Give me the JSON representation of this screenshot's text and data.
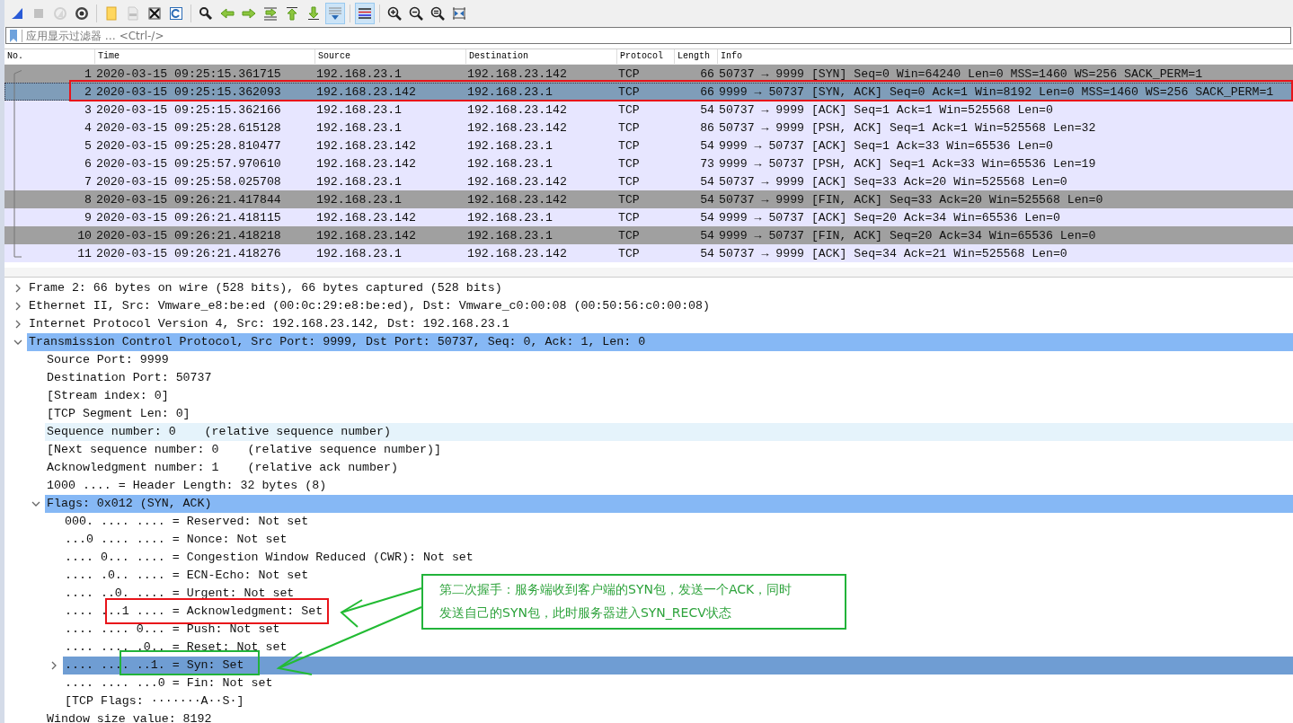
{
  "toolbar": {
    "buttons": [
      {
        "selected": false,
        "disabled": false
      },
      {
        "selected": false,
        "disabled": true
      },
      {
        "selected": false,
        "disabled": true
      },
      {
        "selected": false,
        "disabled": false
      },
      {
        "selected": false,
        "disabled": false
      },
      {
        "selected": false,
        "disabled": true
      },
      {
        "selected": false,
        "disabled": false
      },
      {
        "selected": false,
        "disabled": false
      },
      {
        "selected": false,
        "disabled": false
      },
      {
        "selected": false,
        "disabled": false
      },
      {
        "selected": false,
        "disabled": false
      },
      {
        "selected": false,
        "disabled": false
      },
      {
        "selected": false,
        "disabled": false
      },
      {
        "selected": false,
        "disabled": false
      },
      {
        "selected": true,
        "disabled": false
      },
      {
        "selected": true,
        "disabled": false
      },
      {
        "selected": false,
        "disabled": false
      },
      {
        "selected": false,
        "disabled": false
      },
      {
        "selected": false,
        "disabled": false
      },
      {
        "selected": false,
        "disabled": false
      }
    ]
  },
  "filter": {
    "placeholder": "应用显示过滤器 … <Ctrl-/>"
  },
  "packet_list": {
    "columns": [
      "No.",
      "Time",
      "Source",
      "Destination",
      "Protocol",
      "Length",
      "Info"
    ],
    "rows": [
      {
        "no": "1",
        "time": "2020-03-15 09:25:15.361715",
        "source": "192.168.23.1",
        "destination": "192.168.23.142",
        "protocol": "TCP",
        "length": "66",
        "info": "50737 → 9999 [SYN] Seq=0 Win=64240 Len=0 MSS=1460 WS=256 SACK_PERM=1",
        "color": "#a0a0a0",
        "selected": false
      },
      {
        "no": "2",
        "time": "2020-03-15 09:25:15.362093",
        "source": "192.168.23.142",
        "destination": "192.168.23.1",
        "protocol": "TCP",
        "length": "66",
        "info": "9999 → 50737 [SYN, ACK] Seq=0 Ack=1 Win=8192 Len=0 MSS=1460 WS=256 SACK_PERM=1",
        "color": "#7f9db9",
        "selected": true
      },
      {
        "no": "3",
        "time": "2020-03-15 09:25:15.362166",
        "source": "192.168.23.1",
        "destination": "192.168.23.142",
        "protocol": "TCP",
        "length": "54",
        "info": "50737 → 9999 [ACK] Seq=1 Ack=1 Win=525568 Len=0",
        "color": "#e7e6ff",
        "selected": false
      },
      {
        "no": "4",
        "time": "2020-03-15 09:25:28.615128",
        "source": "192.168.23.1",
        "destination": "192.168.23.142",
        "protocol": "TCP",
        "length": "86",
        "info": "50737 → 9999 [PSH, ACK] Seq=1 Ack=1 Win=525568 Len=32",
        "color": "#e7e6ff",
        "selected": false
      },
      {
        "no": "5",
        "time": "2020-03-15 09:25:28.810477",
        "source": "192.168.23.142",
        "destination": "192.168.23.1",
        "protocol": "TCP",
        "length": "54",
        "info": "9999 → 50737 [ACK] Seq=1 Ack=33 Win=65536 Len=0",
        "color": "#e7e6ff",
        "selected": false
      },
      {
        "no": "6",
        "time": "2020-03-15 09:25:57.970610",
        "source": "192.168.23.142",
        "destination": "192.168.23.1",
        "protocol": "TCP",
        "length": "73",
        "info": "9999 → 50737 [PSH, ACK] Seq=1 Ack=33 Win=65536 Len=19",
        "color": "#e7e6ff",
        "selected": false
      },
      {
        "no": "7",
        "time": "2020-03-15 09:25:58.025708",
        "source": "192.168.23.1",
        "destination": "192.168.23.142",
        "protocol": "TCP",
        "length": "54",
        "info": "50737 → 9999 [ACK] Seq=33 Ack=20 Win=525568 Len=0",
        "color": "#e7e6ff",
        "selected": false
      },
      {
        "no": "8",
        "time": "2020-03-15 09:26:21.417844",
        "source": "192.168.23.1",
        "destination": "192.168.23.142",
        "protocol": "TCP",
        "length": "54",
        "info": "50737 → 9999 [FIN, ACK] Seq=33 Ack=20 Win=525568 Len=0",
        "color": "#a0a0a0",
        "selected": false
      },
      {
        "no": "9",
        "time": "2020-03-15 09:26:21.418115",
        "source": "192.168.23.142",
        "destination": "192.168.23.1",
        "protocol": "TCP",
        "length": "54",
        "info": "9999 → 50737 [ACK] Seq=20 Ack=34 Win=65536 Len=0",
        "color": "#e7e6ff",
        "selected": false
      },
      {
        "no": "10",
        "time": "2020-03-15 09:26:21.418218",
        "source": "192.168.23.142",
        "destination": "192.168.23.1",
        "protocol": "TCP",
        "length": "54",
        "info": "9999 → 50737 [FIN, ACK] Seq=20 Ack=34 Win=65536 Len=0",
        "color": "#a0a0a0",
        "selected": false
      },
      {
        "no": "11",
        "time": "2020-03-15 09:26:21.418276",
        "source": "192.168.23.1",
        "destination": "192.168.23.142",
        "protocol": "TCP",
        "length": "54",
        "info": "50737 → 9999 [ACK] Seq=34 Ack=21 Win=525568 Len=0",
        "color": "#e7e6ff",
        "selected": false
      }
    ]
  },
  "details": [
    {
      "label": "Frame 2: 66 bytes on wire (528 bits), 66 bytes captured (528 bits)",
      "expanded": false,
      "selected": false
    },
    {
      "label": "Ethernet II, Src: Vmware_e8:be:ed (00:0c:29:e8:be:ed), Dst: Vmware_c0:00:08 (00:50:56:c0:00:08)",
      "expanded": false,
      "selected": false
    },
    {
      "label": "Internet Protocol Version 4, Src: 192.168.23.142, Dst: 192.168.23.1",
      "expanded": false,
      "selected": false
    },
    {
      "label": "Transmission Control Protocol, Src Port: 9999, Dst Port: 50737, Seq: 0, Ack: 1, Len: 0",
      "expanded": true,
      "selected": false,
      "related": true,
      "children": [
        {
          "label": "Source Port: 9999",
          "selected": false
        },
        {
          "label": "Destination Port: 50737",
          "selected": false
        },
        {
          "label": "[Stream index: 0]",
          "selected": false
        },
        {
          "label": "[TCP Segment Len: 0]",
          "selected": false
        },
        {
          "label": "Sequence number: 0    (relative sequence number)",
          "selected": false,
          "hover": true
        },
        {
          "label": "[Next sequence number: 0    (relative sequence number)]",
          "selected": false
        },
        {
          "label": "Acknowledgment number: 1    (relative ack number)",
          "selected": false
        },
        {
          "label": "1000 .... = Header Length: 32 bytes (8)",
          "selected": false
        },
        {
          "label": "Flags: 0x012 (SYN, ACK)",
          "expanded": true,
          "selected": false,
          "related": true,
          "children": [
            {
              "label": "000. .... .... = Reserved: Not set",
              "selected": false
            },
            {
              "label": "...0 .... .... = Nonce: Not set",
              "selected": false
            },
            {
              "label": ".... 0... .... = Congestion Window Reduced (CWR): Not set",
              "selected": false
            },
            {
              "label": ".... .0.. .... = ECN-Echo: Not set",
              "selected": false
            },
            {
              "label": ".... ..0. .... = Urgent: Not set",
              "selected": false
            },
            {
              "label": ".... ...1 .... = Acknowledgment: Set",
              "selected": false
            },
            {
              "label": ".... .... 0... = Push: Not set",
              "selected": false
            },
            {
              "label": ".... .... .0.. = Reset: Not set",
              "selected": false
            },
            {
              "label": ".... .... ..1. = Syn: Set",
              "expanded": false,
              "selected": true
            },
            {
              "label": ".... .... ...0 = Fin: Not set",
              "selected": false
            },
            {
              "label": "[TCP Flags: ·······A··S·]",
              "selected": false
            }
          ]
        },
        {
          "label": "Window size value: 8192",
          "selected": false
        }
      ]
    }
  ],
  "annotation": {
    "lines": [
      "第二次握手：服务端收到客户端的SYN包，发送一个ACK，同时",
      "发送自己的SYN包，此时服务器进入SYN_RECV状态"
    ]
  }
}
